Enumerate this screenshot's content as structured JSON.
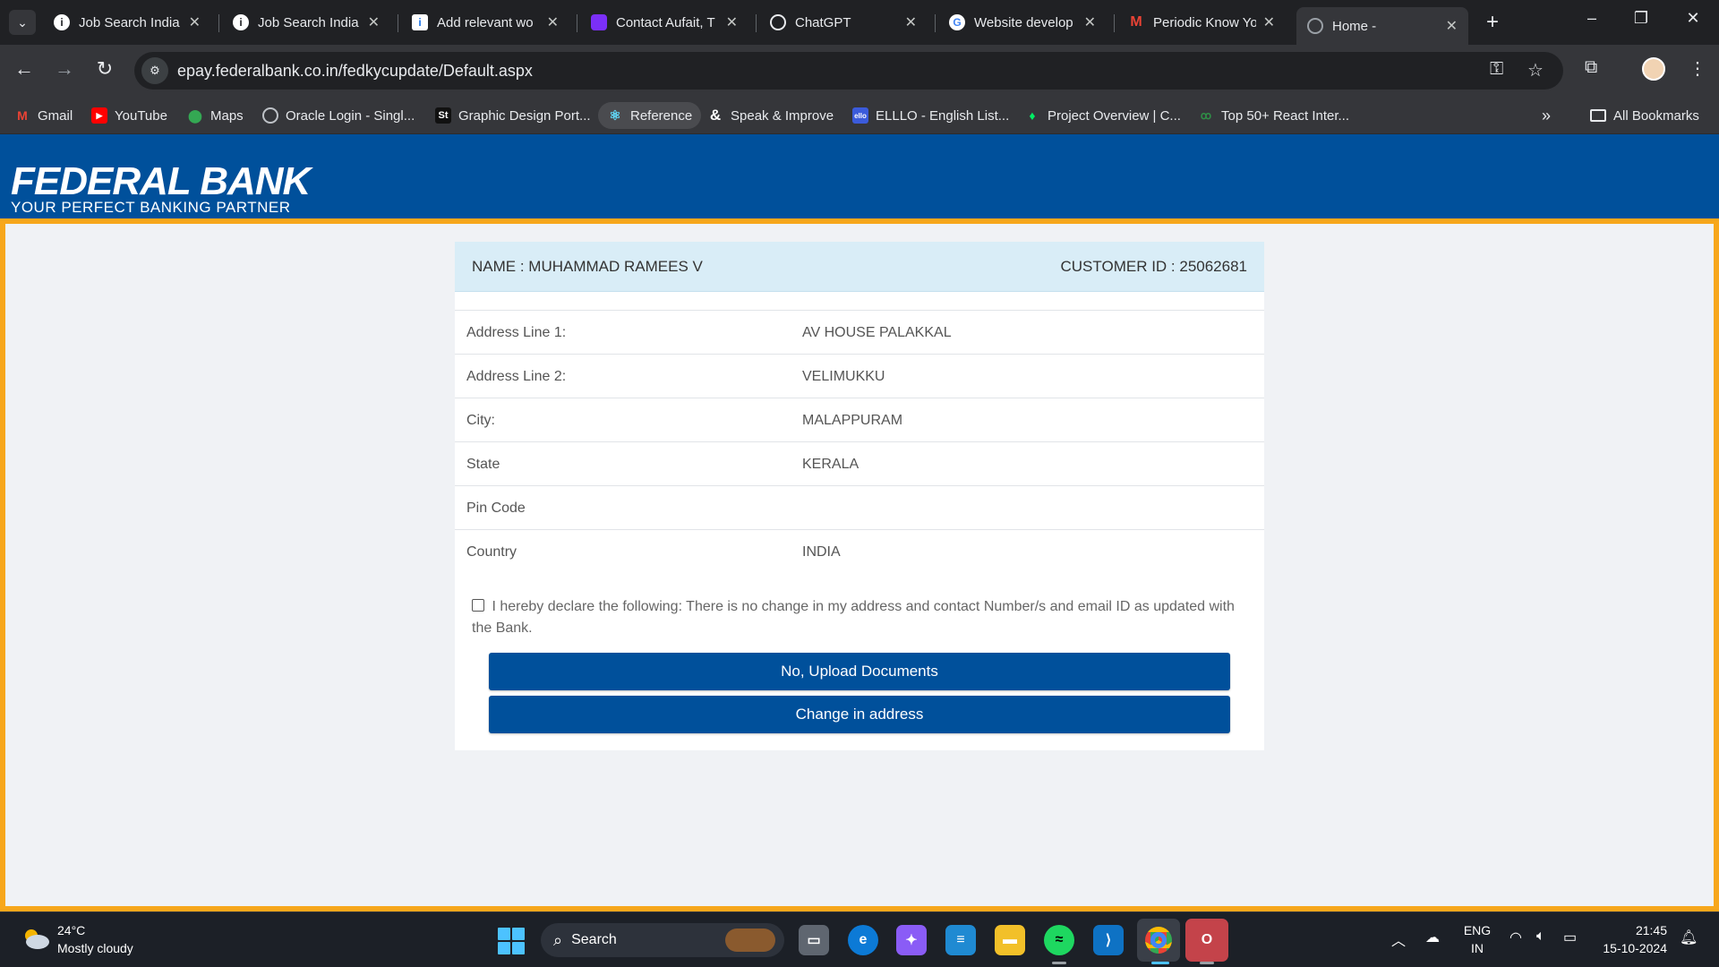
{
  "browser": {
    "tabs": [
      {
        "title": "Job Search India",
        "favicon": "info-icon",
        "active": false
      },
      {
        "title": "Job Search India",
        "favicon": "info-icon",
        "active": false
      },
      {
        "title": "Add relevant wo",
        "favicon": "bookmark-doc-icon",
        "active": false
      },
      {
        "title": "Contact Aufait, T",
        "favicon": "purple-app-icon",
        "active": false
      },
      {
        "title": "ChatGPT",
        "favicon": "chatgpt-icon",
        "active": false
      },
      {
        "title": "Website develop",
        "favicon": "google-icon",
        "active": false
      },
      {
        "title": "Periodic Know Yo",
        "favicon": "gmail-icon",
        "active": false
      },
      {
        "title": "Home -",
        "favicon": "globe-icon",
        "active": true
      }
    ],
    "url": "epay.federalbank.co.in/fedkycupdate/Default.aspx",
    "bookmarks": [
      {
        "label": "Gmail",
        "icon": "gmail-icon"
      },
      {
        "label": "YouTube",
        "icon": "youtube-icon"
      },
      {
        "label": "Maps",
        "icon": "maps-icon"
      },
      {
        "label": "Oracle Login - Singl...",
        "icon": "globe-icon"
      },
      {
        "label": "Graphic Design Port...",
        "icon": "st-icon"
      },
      {
        "label": "Reference",
        "icon": "react-icon"
      },
      {
        "label": "Speak & Improve",
        "icon": "ampersand-icon"
      },
      {
        "label": "ELLLO - English List...",
        "icon": "ello-icon"
      },
      {
        "label": "Project Overview | C...",
        "icon": "mongodb-leaf-icon"
      },
      {
        "label": "Top 50+ React Inter...",
        "icon": "gfg-icon"
      }
    ],
    "all_bookmarks": "All Bookmarks"
  },
  "page": {
    "logo_main": "FEDERAL BANK",
    "logo_sub": "YOUR PERFECT BANKING PARTNER",
    "name_line": "NAME : MUHAMMAD RAMEES V",
    "customer_line": "CUSTOMER ID : 25062681",
    "rows": [
      {
        "label": "Address Line 1:",
        "value": "AV HOUSE PALAKKAL"
      },
      {
        "label": "Address Line 2:",
        "value": "VELIMUKKU"
      },
      {
        "label": "City:",
        "value": "MALAPPURAM"
      },
      {
        "label": "State",
        "value": "KERALA"
      },
      {
        "label": "Pin Code",
        "value": ""
      },
      {
        "label": "Country",
        "value": "INDIA"
      }
    ],
    "declaration": "I hereby declare the following: There is no change in my address and contact Number/s and email ID as updated with the Bank.",
    "btn_upload": "No, Upload Documents",
    "btn_change": "Change in address",
    "colors": {
      "brand_blue": "#00509b",
      "accent_orange": "#f7a71b",
      "header_bg": "#d9edf7"
    }
  },
  "taskbar": {
    "temp": "24°C",
    "weather": "Mostly cloudy",
    "search": "Search",
    "lang_top": "ENG",
    "lang_bottom": "IN",
    "time": "21:45",
    "date": "15-10-2024"
  }
}
